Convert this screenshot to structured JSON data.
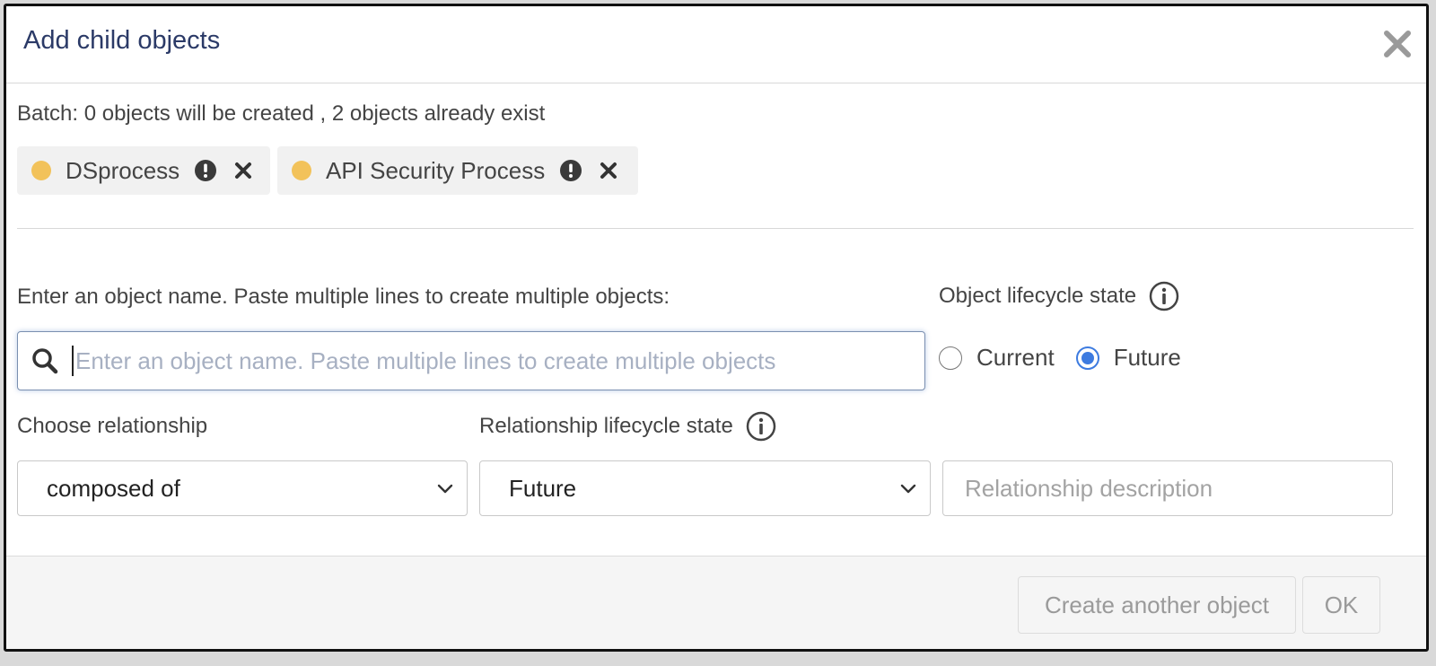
{
  "dialog": {
    "title": "Add child objects",
    "close_icon": "close-icon"
  },
  "batch": {
    "summary": "Batch: 0 objects will be created , 2 objects already exist",
    "items": [
      {
        "label": "DSprocess",
        "dot_color": "#f2c25a",
        "status_icon": "exclamation-circle-icon",
        "remove_icon": "close-icon"
      },
      {
        "label": "API Security Process",
        "dot_color": "#f2c25a",
        "status_icon": "exclamation-circle-icon",
        "remove_icon": "close-icon"
      }
    ]
  },
  "object_name": {
    "label": "Enter an object name. Paste multiple lines to create multiple objects:",
    "placeholder": "Enter an object name. Paste multiple lines to create multiple objects",
    "value": "",
    "icon": "search-icon"
  },
  "object_lifecycle": {
    "label": "Object lifecycle state",
    "info_icon": "info-icon",
    "options": [
      {
        "label": "Current",
        "checked": false
      },
      {
        "label": "Future",
        "checked": true
      }
    ],
    "accent_color": "#3d7be0"
  },
  "relationship": {
    "label": "Choose relationship",
    "selected": "composed of"
  },
  "relationship_lifecycle": {
    "label": "Relationship lifecycle state",
    "info_icon": "info-icon",
    "selected": "Future"
  },
  "relationship_description": {
    "placeholder": "Relationship description",
    "value": ""
  },
  "footer": {
    "create_another_label": "Create another object",
    "ok_label": "OK"
  }
}
